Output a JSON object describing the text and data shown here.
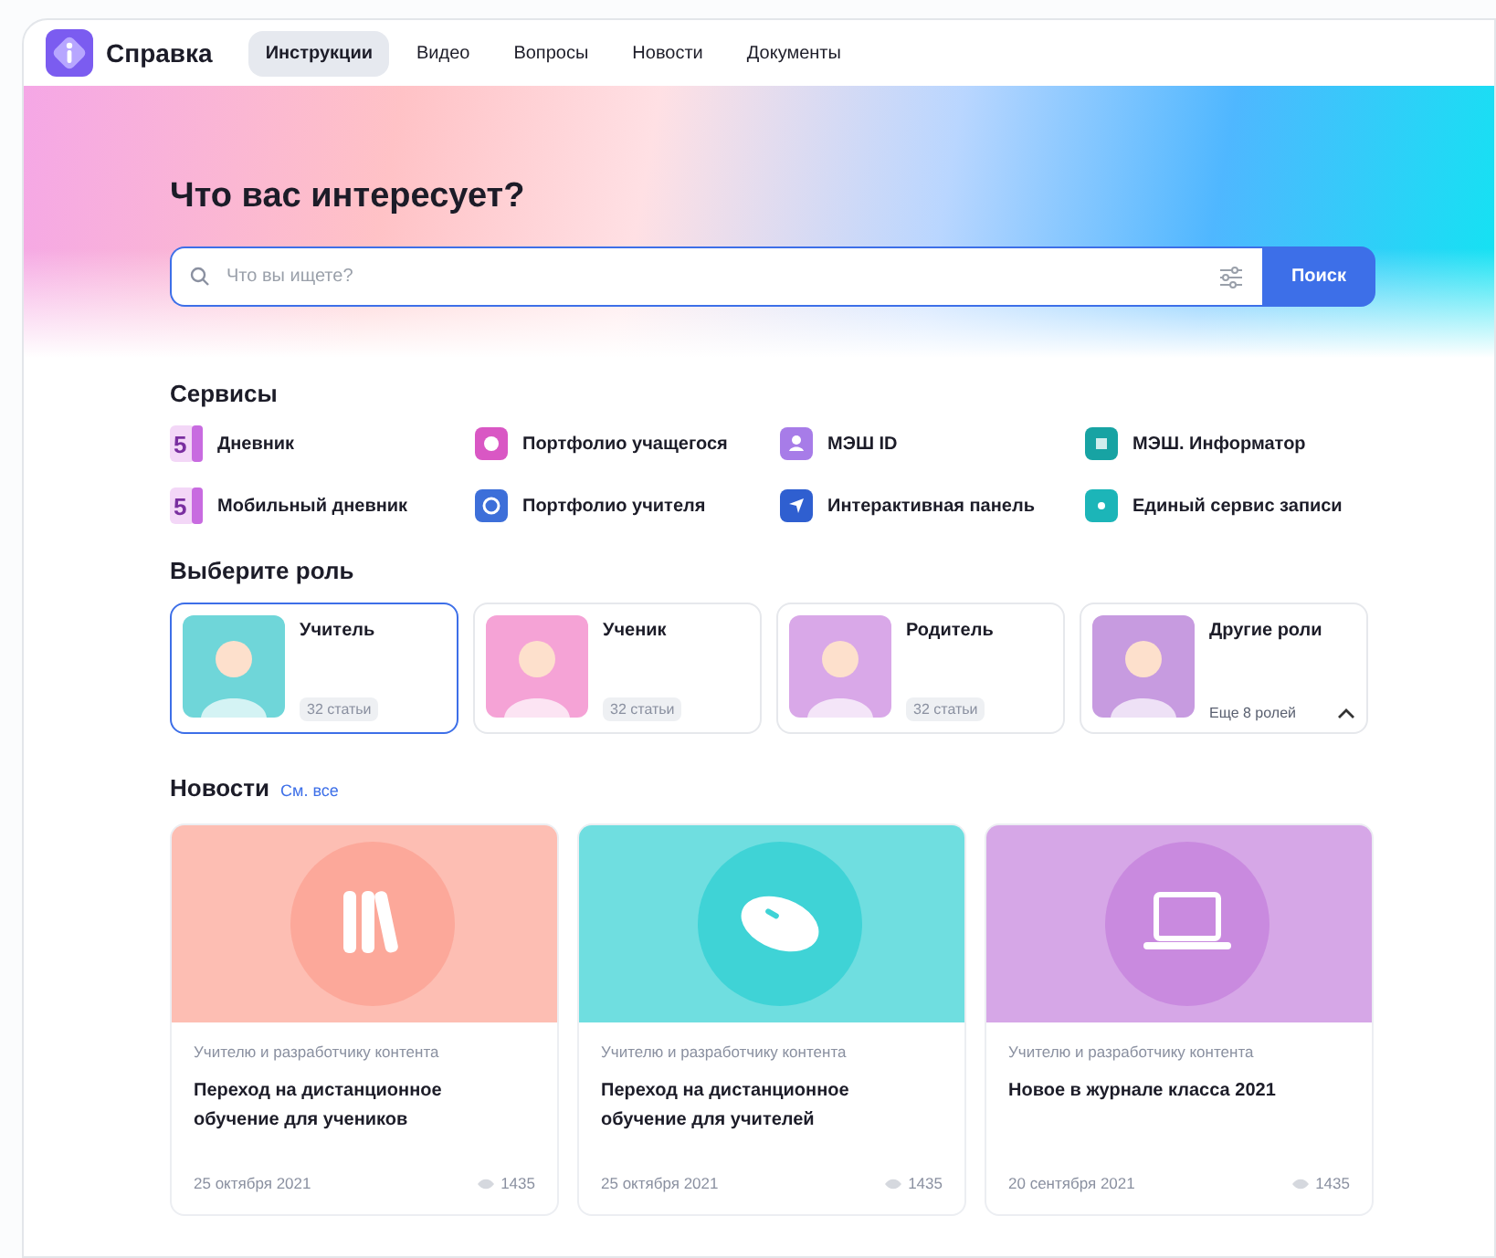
{
  "nav": {
    "logo_text": "Справка",
    "tabs": [
      {
        "label": "Инструкции",
        "selected": true
      },
      {
        "label": "Видео",
        "selected": false
      },
      {
        "label": "Вопросы",
        "selected": false
      },
      {
        "label": "Новости",
        "selected": false
      },
      {
        "label": "Документы",
        "selected": false
      }
    ]
  },
  "hero": {
    "title": "Что вас интересует?",
    "search": {
      "placeholder": "Что вы ищете?",
      "button": "Поиск"
    }
  },
  "services": {
    "title": "Сервисы",
    "items": [
      {
        "label": "Дневник",
        "color": "#c86be0",
        "kind": "digit",
        "glyph": "5"
      },
      {
        "label": "Портфолио учащегося",
        "color": "#d957c4",
        "kind": "circle"
      },
      {
        "label": "МЭШ ID",
        "color": "#a77ce8",
        "kind": "person"
      },
      {
        "label": "МЭШ. Информатор",
        "color": "#17a3a3",
        "kind": "square"
      },
      {
        "label": "Мобильный дневник",
        "color": "#c86be0",
        "kind": "digit",
        "glyph": "5"
      },
      {
        "label": "Портфолио учителя",
        "color": "#3d6fd9",
        "kind": "check"
      },
      {
        "label": "Интерактивная панель",
        "color": "#2f5fd0",
        "kind": "arrow"
      },
      {
        "label": "Единый сервис записи",
        "color": "#1cb5b8",
        "kind": "dot"
      }
    ]
  },
  "roles": {
    "title": "Выберите роль",
    "items": [
      {
        "name": "Учитель",
        "kind": "role",
        "note": "32 статьи",
        "selected": true,
        "color": "#6fd6d9"
      },
      {
        "name": "Ученик",
        "kind": "role",
        "note": "32 статьи",
        "selected": false,
        "color": "#f5a3d6"
      },
      {
        "name": "Родитель",
        "kind": "role",
        "note": "32 статьи",
        "selected": false,
        "color": "#d9a8e8"
      },
      {
        "name": "Другие роли",
        "kind": "more",
        "note": "Еще 8 ролей",
        "selected": false,
        "color": "#c79be0"
      }
    ]
  },
  "news": {
    "title": "Новости",
    "link": "См. все",
    "items": [
      {
        "category": "Учителю и разработчику контента",
        "title": "Переход на дистанционное обучение для учеников",
        "date": "25 октября 2021",
        "views": "1435",
        "color": "#fca89a",
        "kind": "books"
      },
      {
        "category": "Учителю и разработчику контента",
        "title": "Переход на дистанционное обучение для учителей",
        "date": "25 октября 2021",
        "views": "1435",
        "color": "#3fd3d6",
        "kind": "mouse"
      },
      {
        "category": "Учителю и разработчику контента",
        "title": "Новое в журнале класса 2021",
        "date": "20 сентября 2021",
        "views": "1435",
        "color": "#c98adf",
        "kind": "laptop"
      }
    ]
  }
}
